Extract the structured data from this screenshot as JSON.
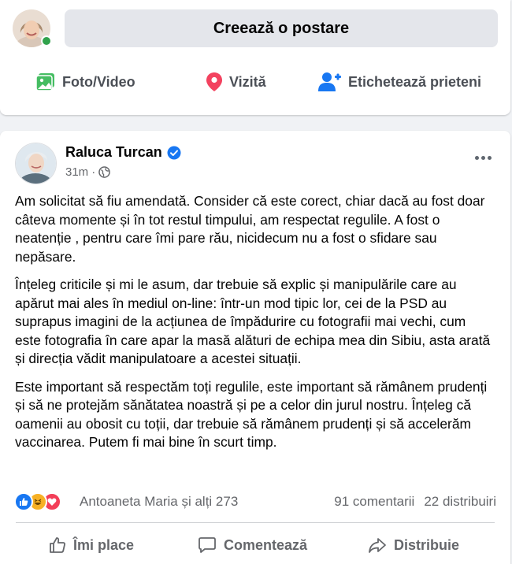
{
  "composer": {
    "create_post_label": "Creează o postare",
    "actions": [
      {
        "label": "Foto/Video",
        "icon": "photo-video-icon",
        "color": "#45bd62"
      },
      {
        "label": "Vizită",
        "icon": "location-pin-icon",
        "color": "#f3425f"
      },
      {
        "label": "Etichetează prieteni",
        "icon": "tag-friends-icon",
        "color": "#1877f2"
      }
    ]
  },
  "post": {
    "author": "Raluca Turcan",
    "verified": true,
    "time": "31m",
    "privacy_icon": "globe-icon",
    "paragraphs": [
      "Am solicitat să fiu amendată. Consider că este corect, chiar dacă au fost doar câteva momente și în tot restul timpului, am respectat regulile. A fost o neatenție , pentru care îmi pare rău, nicidecum nu a fost o sfidare sau nepăsare.",
      "Înțeleg criticile și mi le asum, dar trebuie să explic și manipulările care au apărut mai ales în mediul on-line: într-un mod tipic lor, cei de la PSD au suprapus imagini de la acțiunea de împădurire cu fotografii mai vechi,  cum este fotografia în care apar la masă alături de echipa mea din Sibiu, asta arată și direcția vădit manipulatoare a acestei situații.",
      "Este important să respectăm toți regulile, este important să rămânem prudenți și să ne protejăm sănătatea noastră și pe a celor din jurul nostru. Înțeleg că oamenii au obosit cu toții, dar trebuie să rămânem prudenți și să accelerăm vaccinarea. Putem fi mai bine în scurt timp."
    ],
    "reactions": {
      "icons": [
        "like-reaction-icon",
        "haha-reaction-icon",
        "love-reaction-icon"
      ],
      "names": "Antoaneta Maria și alți 273",
      "comments": "91 comentarii",
      "shares": "22 distribuiri"
    },
    "actions": [
      {
        "label": "Îmi place",
        "icon": "thumbs-up-icon"
      },
      {
        "label": "Comentează",
        "icon": "comment-icon"
      },
      {
        "label": "Distribuie",
        "icon": "share-icon"
      }
    ]
  },
  "colors": {
    "accent": "#1877f2",
    "online": "#31a24c",
    "secondary_text": "#65676b"
  }
}
